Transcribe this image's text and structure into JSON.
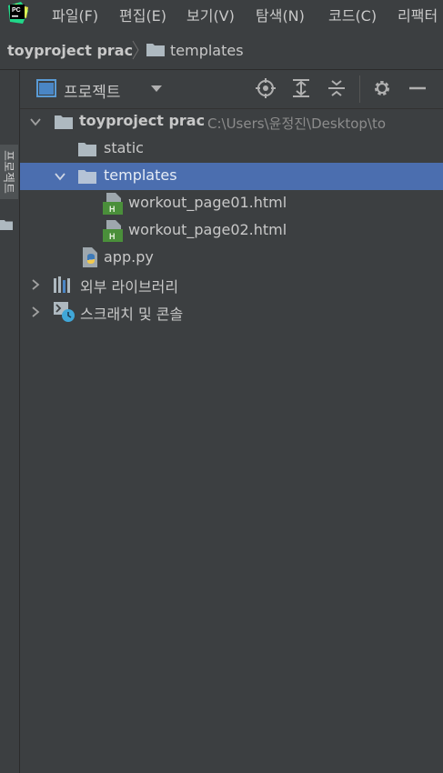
{
  "menubar": {
    "items": [
      "파일(F)",
      "편집(E)",
      "보기(V)",
      "탐색(N)",
      "코드(C)",
      "리팩터"
    ]
  },
  "breadcrumb": {
    "project": "toyproject prac",
    "folder": "templates"
  },
  "tool_stripe": {
    "tab_label": "프로젝트"
  },
  "panel": {
    "title": "프로젝트"
  },
  "tree": {
    "root": {
      "label": "toyproject prac",
      "path": "C:\\Users\\윤정진\\Desktop\\to"
    },
    "static": "static",
    "templates": "templates",
    "file1": "workout_page01.html",
    "file2": "workout_page02.html",
    "app": "app.py",
    "external_libs": "외부 라이브러리",
    "scratches": "스크래치 및 콘솔"
  },
  "colors": {
    "background": "#3c3f41",
    "selection": "#4b6eaf",
    "text": "#c8c8c8",
    "path_text": "#8c8c8c"
  },
  "icons": {
    "app": "pycharm-logo",
    "folder": "folder-icon",
    "html": "html-file-icon",
    "python": "python-file-icon",
    "libraries": "library-icon",
    "scratches": "scratches-icon"
  }
}
